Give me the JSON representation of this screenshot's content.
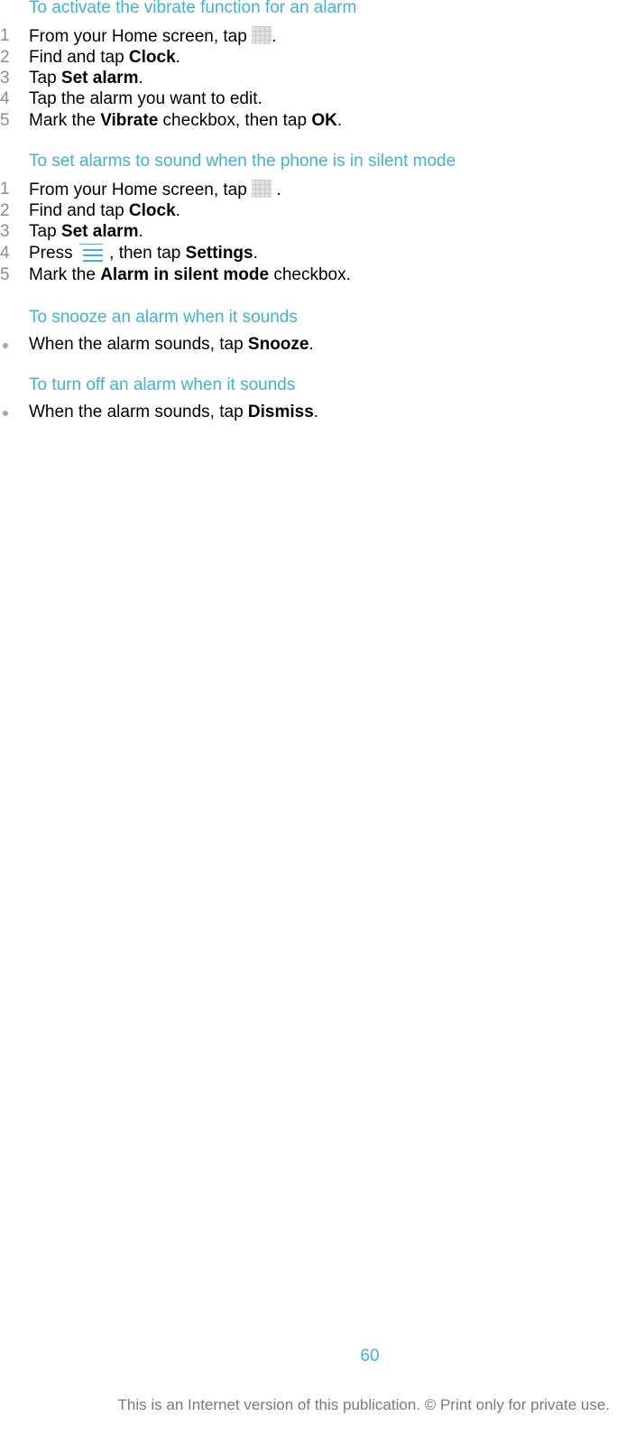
{
  "sections": [
    {
      "heading": "To activate the vibrate function for an alarm",
      "steps": [
        {
          "marker": "1",
          "parts": [
            "From your Home screen, tap ",
            "."
          ]
        },
        {
          "marker": "2",
          "pre": "Find and tap ",
          "bold": "Clock",
          "post": "."
        },
        {
          "marker": "3",
          "pre": "Tap ",
          "bold": "Set alarm",
          "post": "."
        },
        {
          "marker": "4",
          "pre": "Tap the alarm you want to edit.",
          "bold": "",
          "post": ""
        },
        {
          "marker": "5",
          "pre": "Mark the ",
          "bold": "Vibrate",
          "mid": " checkbox, then tap ",
          "bold2": "OK",
          "post": "."
        }
      ]
    },
    {
      "heading": "To set alarms to sound when the phone is in silent mode",
      "steps": [
        {
          "marker": "1",
          "parts": [
            "From your Home screen, tap ",
            " ."
          ]
        },
        {
          "marker": "2",
          "pre": "Find and tap ",
          "bold": "Clock",
          "post": "."
        },
        {
          "marker": "3",
          "pre": "Tap ",
          "bold": "Set alarm",
          "post": "."
        },
        {
          "marker": "4",
          "pre": "Press ",
          "mid": " , then tap ",
          "bold": "Settings",
          "post": "."
        },
        {
          "marker": "5",
          "pre": "Mark the ",
          "bold": "Alarm in silent mode",
          "post": " checkbox."
        }
      ]
    },
    {
      "heading": "To snooze an alarm when it sounds",
      "steps": [
        {
          "marker": "bullet",
          "pre": "When the alarm sounds, tap ",
          "bold": "Snooze",
          "post": "."
        }
      ]
    },
    {
      "heading": "To turn off an alarm when it sounds",
      "steps": [
        {
          "marker": "bullet",
          "pre": "When the alarm sounds, tap ",
          "bold": "Dismiss",
          "post": "."
        }
      ]
    }
  ],
  "icons": {
    "apps": "apps-grid-icon",
    "menu": "menu-icon"
  },
  "footer": {
    "page_number": "60",
    "notice": "This is an Internet version of this publication. © Print only for private use."
  },
  "colors": {
    "heading": "#3cb4d8",
    "marker": "#8c8c8c",
    "footer": "#7a7a7a"
  }
}
